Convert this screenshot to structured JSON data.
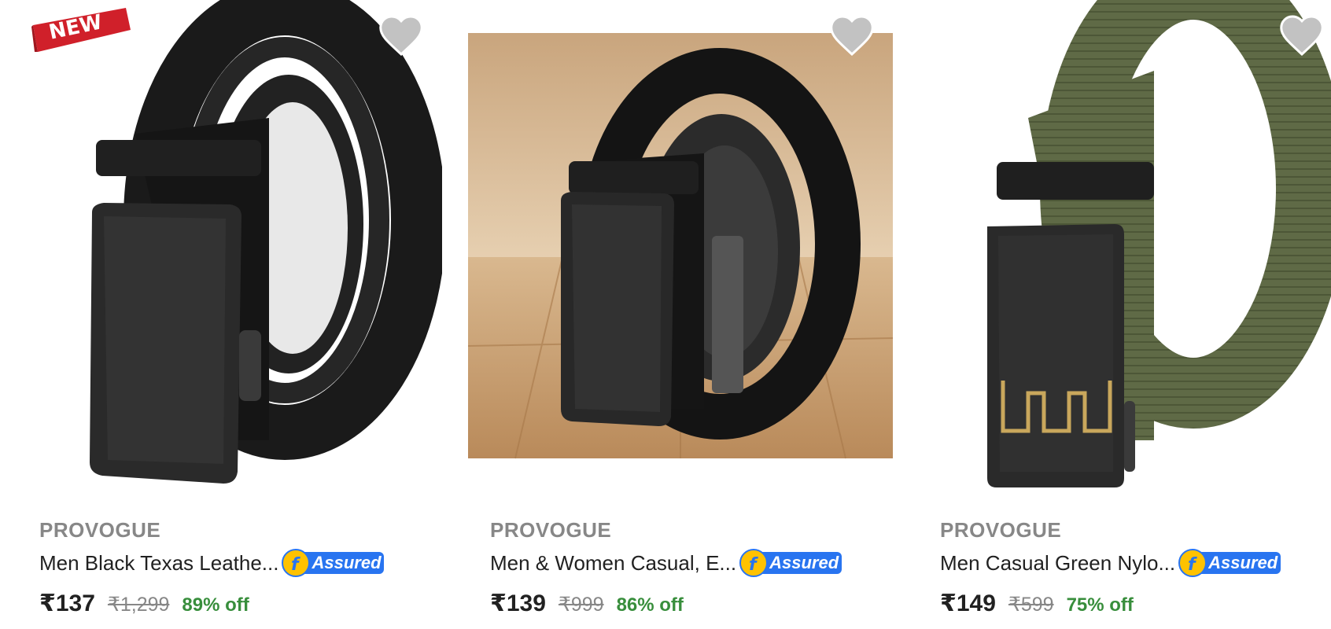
{
  "products": [
    {
      "badge": "NEW",
      "brand": "PROVOGUE",
      "title": "Men Black Texas Leathe...",
      "assured_label": "Assured",
      "price": "₹137",
      "mrp": "₹1,299",
      "discount": "89% off",
      "image_icon": "black-leather-belt-image"
    },
    {
      "brand": "PROVOGUE",
      "title": "Men & Women Casual, E...",
      "assured_label": "Assured",
      "price": "₹139",
      "mrp": "₹999",
      "discount": "86% off",
      "image_icon": "black-leather-belt-on-wood-image"
    },
    {
      "brand": "PROVOGUE",
      "title": "Men Casual Green Nylo...",
      "assured_label": "Assured",
      "price": "₹149",
      "mrp": "₹599",
      "discount": "75% off",
      "image_icon": "green-nylon-belt-image"
    }
  ],
  "colors": {
    "brand_text": "#878787",
    "title_text": "#212121",
    "discount_green": "#388e3c",
    "assured_blue": "#2874f0",
    "assured_yellow": "#ffc200",
    "badge_red": "#d0202a",
    "wishlist_grey": "#c2c2c2"
  },
  "icons": {
    "wishlist": "heart-icon",
    "assured": "flipkart-f-icon"
  }
}
